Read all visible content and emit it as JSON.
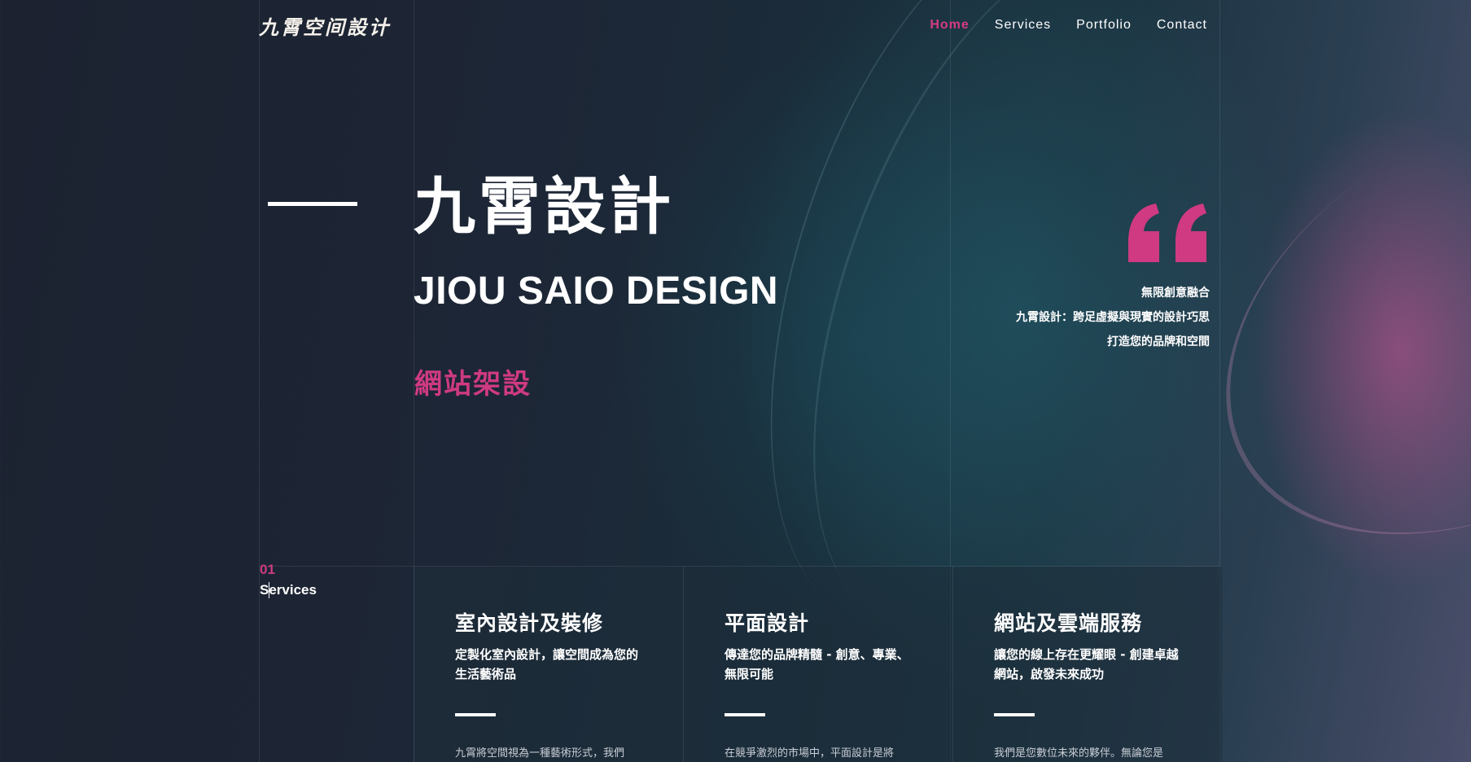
{
  "header": {
    "logo": "九霄空间設计",
    "nav": [
      {
        "label": "Home",
        "active": true
      },
      {
        "label": "Services",
        "active": false
      },
      {
        "label": "Portfolio",
        "active": false
      },
      {
        "label": "Contact",
        "active": false
      }
    ]
  },
  "hero": {
    "title": "九霄設計",
    "subtitle": "JIOU SAIO DESIGN",
    "tagline": "網站架設"
  },
  "quote": {
    "icon": "quote-icon",
    "lines": [
      "無限創意融合",
      "九霄設計：跨足虛擬與現實的設計巧思",
      "打造您的品牌和空間"
    ]
  },
  "services": {
    "number": "01",
    "label": "Services",
    "cards": [
      {
        "title": "室內設計及裝修",
        "lead": "定製化室內設計，讓空間成為您的生活藝術品",
        "body": "九霄將空間視為一種藝術形式，我們"
      },
      {
        "title": "平面設計",
        "lead": "傳達您的品牌精髓 - 創意、專業、無限可能",
        "body": "在競爭激烈的市場中，平面設計是將"
      },
      {
        "title": "網站及雲端服務",
        "lead": "讓您的線上存在更耀眼 - 創建卓越網站，啟發未來成功",
        "body": "我們是您數位未來的夥伴。無論您是"
      }
    ]
  },
  "colors": {
    "accent": "#cf3a82",
    "text": "#ffffff",
    "background": "#1d2636"
  }
}
